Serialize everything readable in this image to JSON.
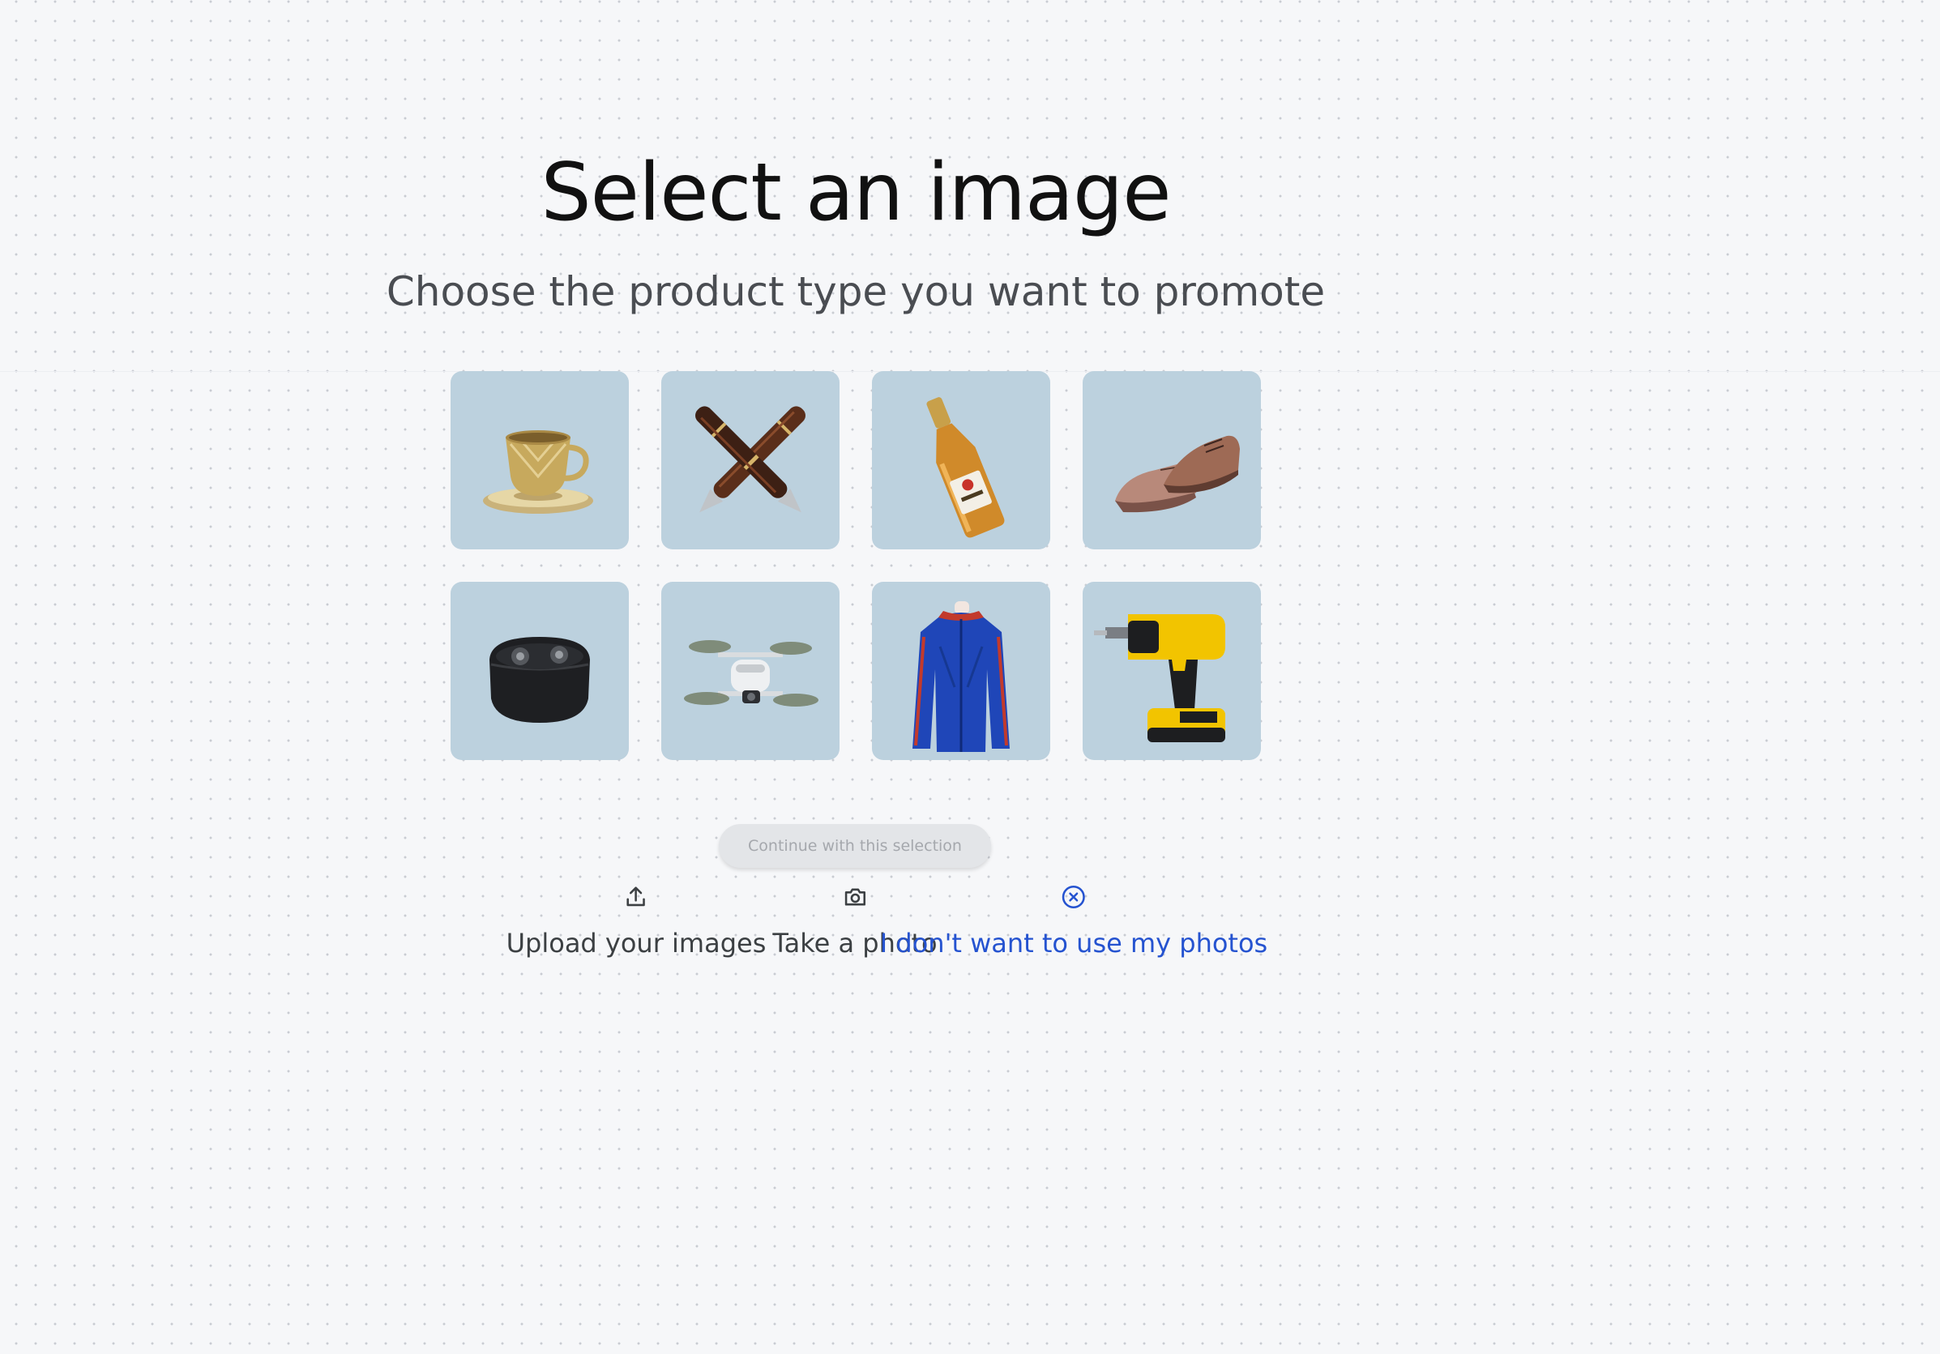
{
  "page": {
    "title": "Select an image",
    "subtitle": "Choose the product type you want to promote"
  },
  "products": [
    {
      "name": "teacup-image",
      "subject": "gold teacup with saucer"
    },
    {
      "name": "fountain-pens-image",
      "subject": "two crossed fountain pens"
    },
    {
      "name": "champagne-bottle-image",
      "subject": "champagne bottle"
    },
    {
      "name": "dress-shoes-image",
      "subject": "pair of brown dress shoes"
    },
    {
      "name": "earbuds-case-image",
      "subject": "black wireless earbuds case"
    },
    {
      "name": "drone-image",
      "subject": "white quadcopter drone"
    },
    {
      "name": "jacket-image",
      "subject": "blue athletic jacket on mannequin"
    },
    {
      "name": "power-drill-image",
      "subject": "yellow cordless power drill"
    }
  ],
  "continue_button": {
    "label": "Continue with this selection",
    "state": "disabled"
  },
  "actions": {
    "upload": {
      "label": "Upload your images",
      "icon": "upload-icon"
    },
    "photo": {
      "label": "Take a photo",
      "icon": "camera-icon"
    },
    "skip": {
      "label": "I don't want to use my photos",
      "icon": "cancel-circle-icon"
    }
  },
  "colors": {
    "background": "#f6f7f9",
    "tile": "#bcd1de",
    "link_blue": "#2553d0",
    "muted_text": "#3c4043"
  }
}
